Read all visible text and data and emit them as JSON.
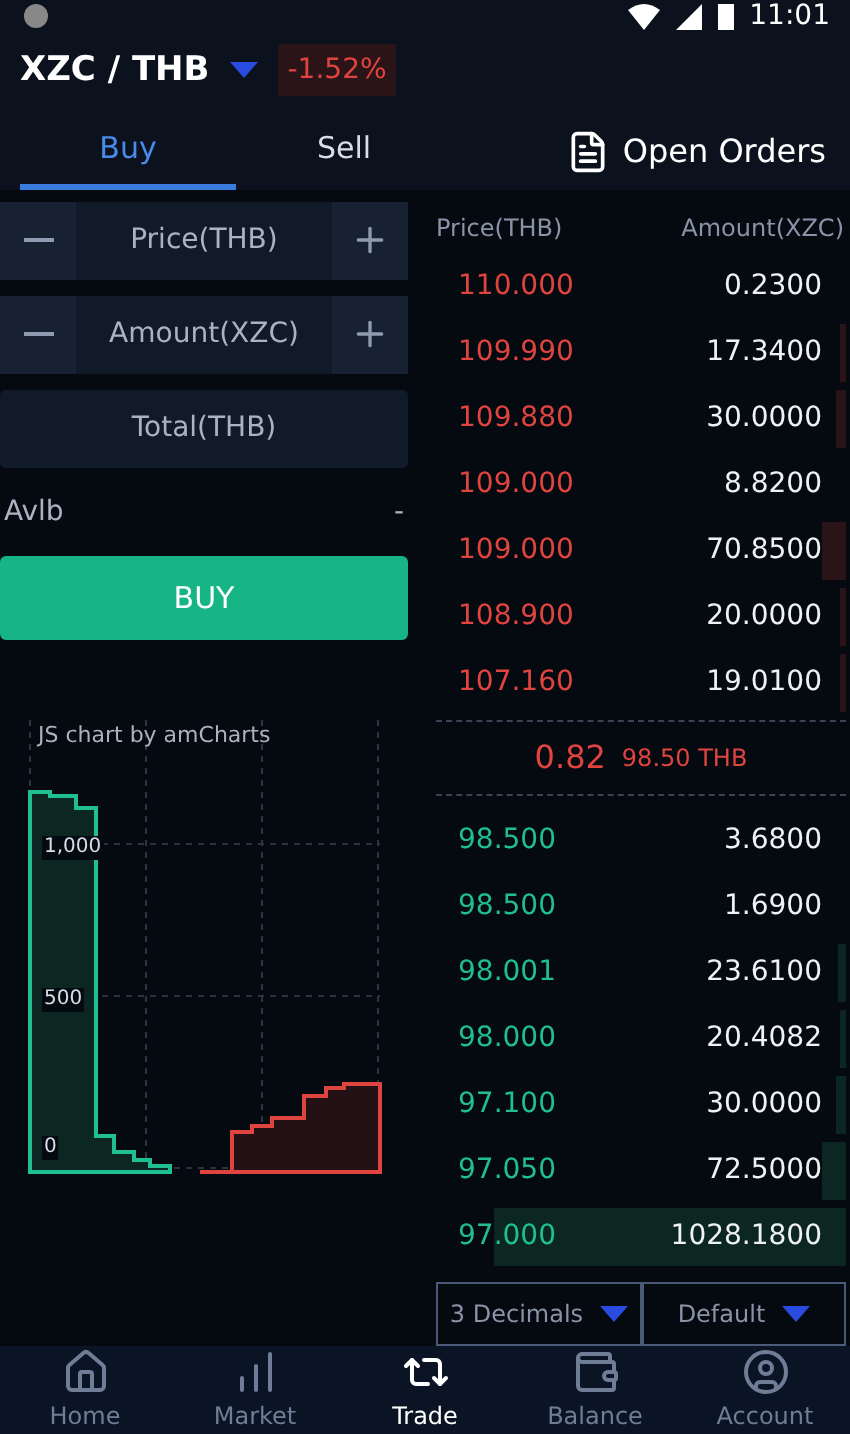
{
  "status_bar": {
    "time": "11:01"
  },
  "header": {
    "pair": "XZC / THB",
    "change": "-1.52%"
  },
  "tabs": [
    {
      "label": "Buy",
      "selected": true
    },
    {
      "label": "Sell",
      "selected": false
    }
  ],
  "open_orders": "Open Orders",
  "form": {
    "price_placeholder": "Price(THB)",
    "amount_placeholder": "Amount(XZC)",
    "total_placeholder": "Total(THB)",
    "available_label": "Avlb",
    "available_value": "-",
    "submit": "BUY"
  },
  "chart": {
    "kind": "picture",
    "credit": "JS chart by amCharts",
    "axis_labels": [
      "1,000",
      "500",
      "0"
    ]
  },
  "order_book": {
    "price_header": "Price(THB)",
    "amount_header": "Amount(XZC)",
    "asks": [
      {
        "price": "110.000",
        "amount": "0.2300"
      },
      {
        "price": "109.990",
        "amount": "17.3400"
      },
      {
        "price": "109.880",
        "amount": "30.0000"
      },
      {
        "price": "109.000",
        "amount": "8.8200"
      },
      {
        "price": "109.000",
        "amount": "70.8500"
      },
      {
        "price": "108.900",
        "amount": "20.0000"
      },
      {
        "price": "107.160",
        "amount": "19.0100"
      }
    ],
    "last": {
      "change": "0.82",
      "price": "98.50 THB"
    },
    "bids": [
      {
        "price": "98.500",
        "amount": "3.6800"
      },
      {
        "price": "98.500",
        "amount": "1.6900"
      },
      {
        "price": "98.001",
        "amount": "23.6100"
      },
      {
        "price": "98.000",
        "amount": "20.4082"
      },
      {
        "price": "97.100",
        "amount": "30.0000"
      },
      {
        "price": "97.050",
        "amount": "72.5000"
      },
      {
        "price": "97.000",
        "amount": "1028.1800"
      }
    ],
    "decimals": "3 Decimals",
    "mode": "Default"
  },
  "nav": [
    {
      "label": "Home",
      "selected": false
    },
    {
      "label": "Market",
      "selected": false
    },
    {
      "label": "Trade",
      "selected": true
    },
    {
      "label": "Balance",
      "selected": false
    },
    {
      "label": "Account",
      "selected": false
    }
  ]
}
